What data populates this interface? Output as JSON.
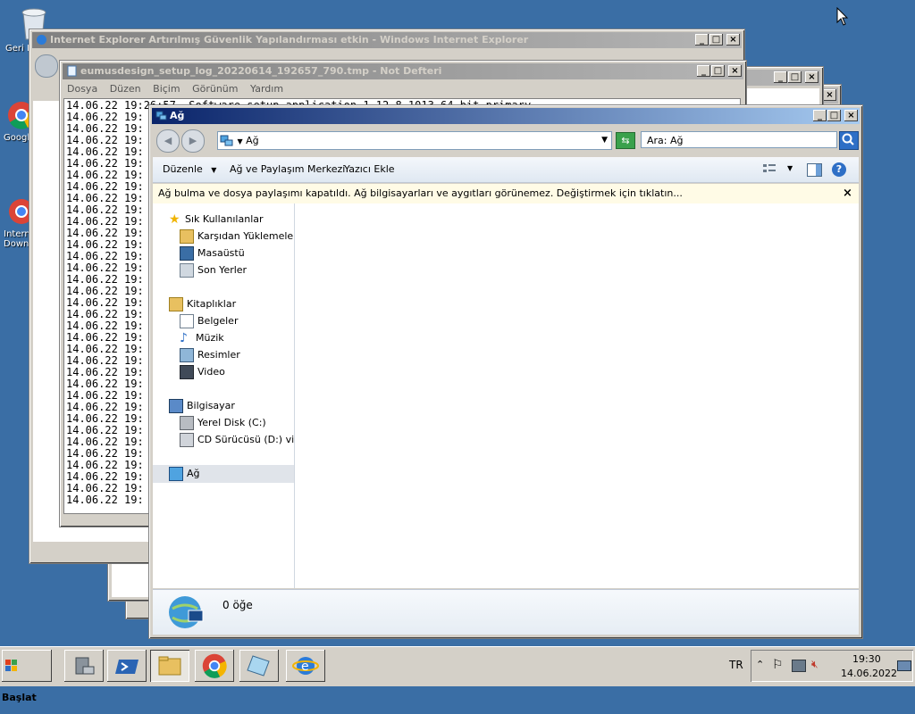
{
  "desktop": {
    "icons": [
      {
        "label": "Geri Dönüşüm Kutusu"
      },
      {
        "label": "Google Chrome"
      },
      {
        "label": "Internet Download"
      }
    ]
  },
  "ie_window": {
    "title": "Internet Explorer Artırılmış Güvenlik Yapılandırması etkin - Windows Internet Explorer"
  },
  "notepad": {
    "title": "eumusdesign_setup_log_20220614_192657_790.tmp - Not Defteri",
    "menu": [
      "Dosya",
      "Düzen",
      "Biçim",
      "Görünüm",
      "Yardım"
    ],
    "first_line": "14.06.22 19:26:57  Software setup application 1.12.8.1013 64-bit primary",
    "line_prefix": "14.06.22 19:",
    "line_count": 35
  },
  "explorer": {
    "title": "Ağ",
    "address": "Ağ",
    "search_placeholder": "Ara: Ağ",
    "toolbar": {
      "organize": "Düzenle",
      "network_center": "Ağ ve Paylaşım Merkezi",
      "add_printer": "Yazıcı Ekle"
    },
    "infobar": "Ağ bulma ve dosya paylaşımı kapatıldı. Ağ bilgisayarları ve aygıtları görünemez. Değiştirmek için tıklatın...",
    "nav": {
      "favorites": "Sık Kullanılanlar",
      "fav_items": [
        "Karşıdan Yüklemeler",
        "Masaüstü",
        "Son Yerler"
      ],
      "libraries": "Kitaplıklar",
      "lib_items": [
        "Belgeler",
        "Müzik",
        "Resimler",
        "Video"
      ],
      "computer": "Bilgisayar",
      "comp_items": [
        "Yerel Disk (C:)",
        "CD Sürücüsü (D:) virtio"
      ],
      "network": "Ağ"
    },
    "status": "0 öğe"
  },
  "taskbar": {
    "start": "Başlat",
    "lang": "TR",
    "time": "19:30",
    "date": "14.06.2022"
  },
  "colors": {
    "desktop": "#3a6ea5",
    "title_active": "#0a246a",
    "infobar": "#fffbe6"
  }
}
